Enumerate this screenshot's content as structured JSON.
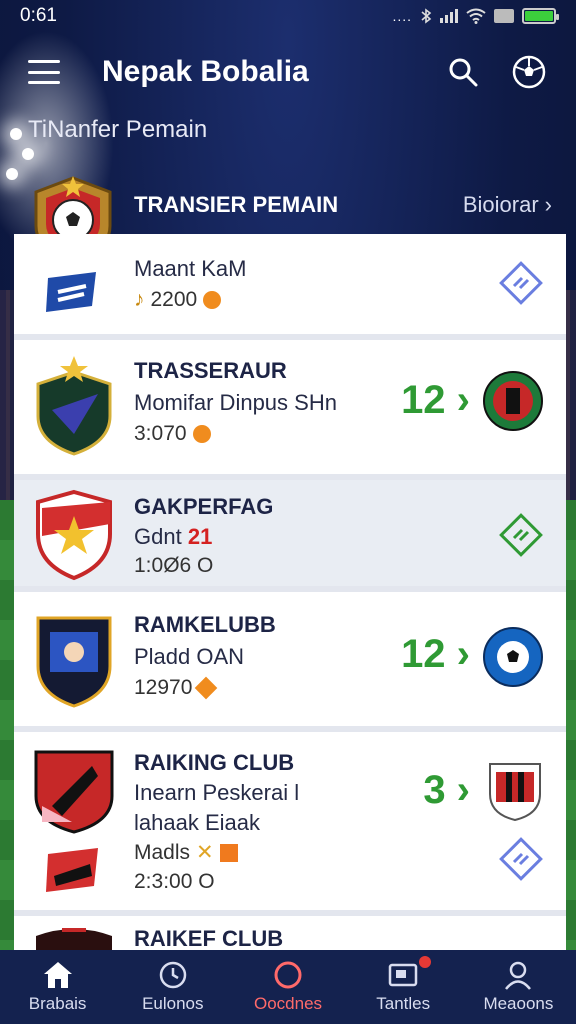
{
  "status_bar": {
    "time": "0:61",
    "dots": "....",
    "battery_level": 1.0
  },
  "app_bar": {
    "title": "Nepak Bobalia"
  },
  "subtitle": "TiNanfer Pemain",
  "section": {
    "title": "TRANSIER PEMAIN",
    "link": "Bioiorar"
  },
  "transfers": [
    {
      "name": "",
      "line1": "Maant KaM",
      "line2": "",
      "meta": "2200",
      "score": ""
    },
    {
      "name": "TRASSERAUR",
      "line1": "Momifar Dinpus SHn",
      "line2": "",
      "meta": "3:070",
      "score": "12 ›"
    },
    {
      "name": "GAKPERFAG",
      "line1": "Gdnt",
      "line1_highlight": "21",
      "line2": "",
      "meta": "1:0Ø6 O",
      "score": ""
    },
    {
      "name": "RAMKELUBB",
      "line1": "Pladd OAN",
      "line2": "",
      "meta": "12970",
      "score": "12 ›"
    },
    {
      "name": "RAIKING CLUB",
      "line1": "Inearn Peskerai l",
      "line2": "lahaak Eiaak",
      "meta2": "Madls",
      "meta": "2:3:00 O",
      "score": "3 ›"
    },
    {
      "name": "RAIKEF CLUB"
    }
  ],
  "nav": [
    {
      "label": "Brabais",
      "icon": "home-icon"
    },
    {
      "label": "Eulonos",
      "icon": "clock-icon"
    },
    {
      "label": "Oocdnes",
      "icon": "ball-icon",
      "active": true
    },
    {
      "label": "Tantles",
      "icon": "message-icon",
      "badge": true
    },
    {
      "label": "Meaoons",
      "icon": "user-icon"
    }
  ],
  "colors": {
    "accent": "#2f9a34",
    "nav_bg": "#14224f",
    "active": "#ff6a6a"
  }
}
